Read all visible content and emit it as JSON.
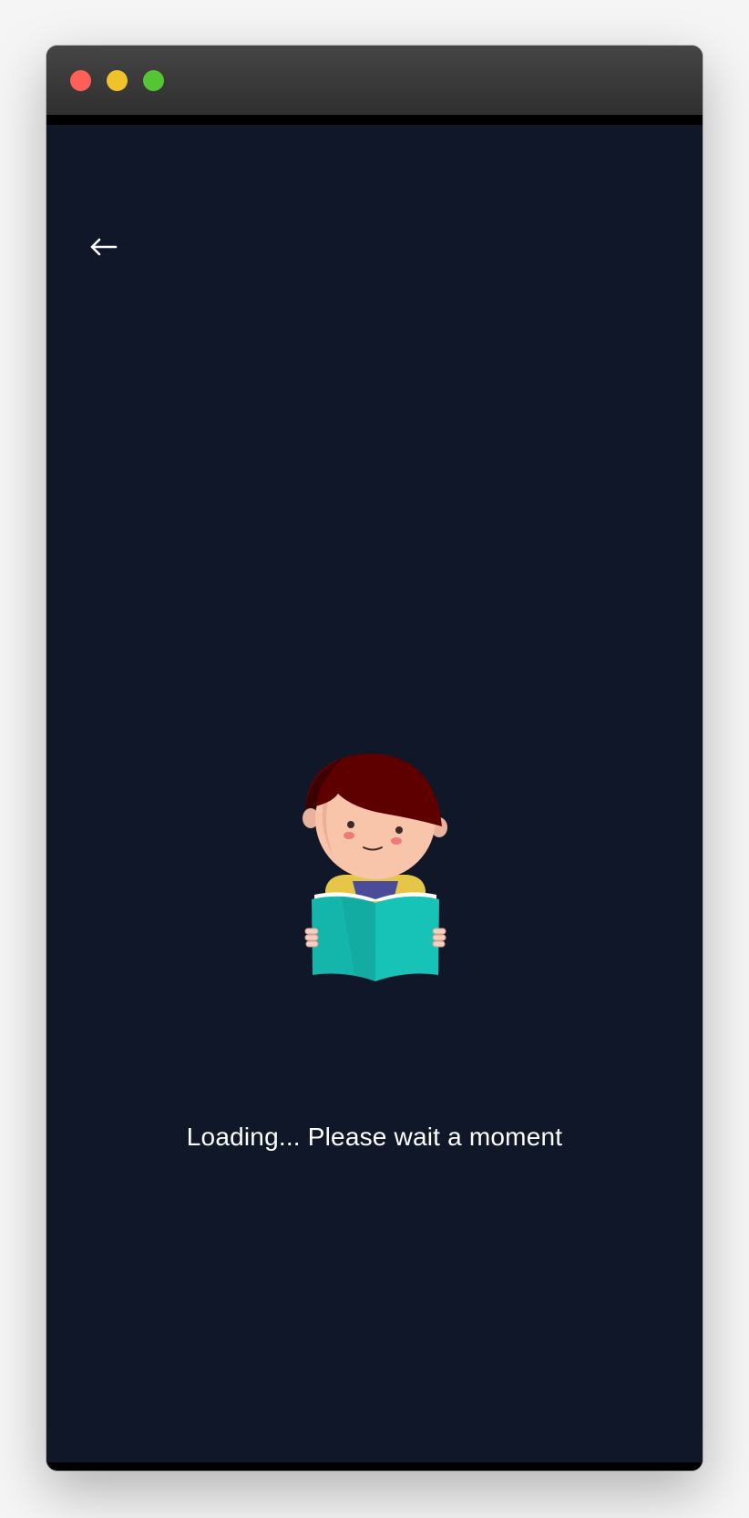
{
  "window": {
    "controls": [
      "close",
      "minimize",
      "zoom"
    ]
  },
  "nav": {
    "back_icon": "arrow-left-icon"
  },
  "loading": {
    "illustration": "child-reading-book",
    "message": "Loading... Please wait a moment"
  },
  "colors": {
    "background": "#101729",
    "text": "#ffffff",
    "book": "#16bdb2",
    "hair": "#5e0000"
  }
}
